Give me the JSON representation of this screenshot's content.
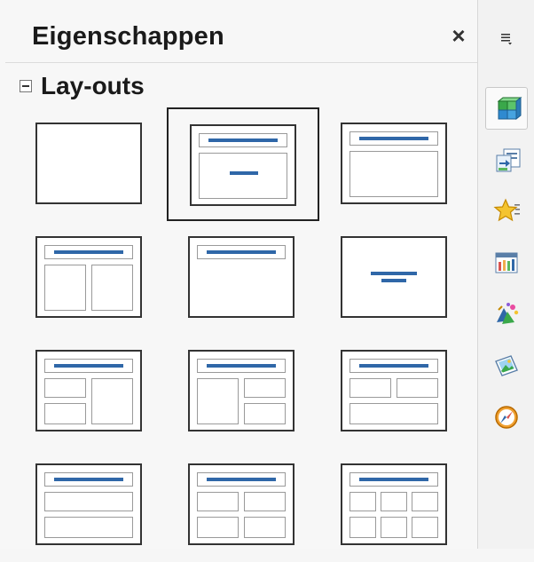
{
  "panel": {
    "title": "Eigenschappen",
    "close_symbol": "×"
  },
  "section": {
    "title": "Lay-outs",
    "collapse_symbol": "minus"
  },
  "layouts": [
    {
      "kind": "blank"
    },
    {
      "kind": "title-slide",
      "selected": true
    },
    {
      "kind": "title-content"
    },
    {
      "kind": "title-2-content"
    },
    {
      "kind": "title-only"
    },
    {
      "kind": "centered-text"
    },
    {
      "kind": "title-2content-and-content"
    },
    {
      "kind": "title-content-and-2content"
    },
    {
      "kind": "title-2content-over-content"
    },
    {
      "kind": "title-content-over-content"
    },
    {
      "kind": "title-4-content"
    },
    {
      "kind": "title-6-content"
    }
  ],
  "tabbar": {
    "items": [
      {
        "icon": "properties-cube-icon",
        "active": true
      },
      {
        "icon": "slide-transition-icon"
      },
      {
        "icon": "animation-star-icon"
      },
      {
        "icon": "master-slides-icon"
      },
      {
        "icon": "styles-icon"
      },
      {
        "icon": "gallery-icon"
      },
      {
        "icon": "navigator-icon"
      }
    ]
  },
  "colors": {
    "accent_bar": "#2f67a8"
  }
}
